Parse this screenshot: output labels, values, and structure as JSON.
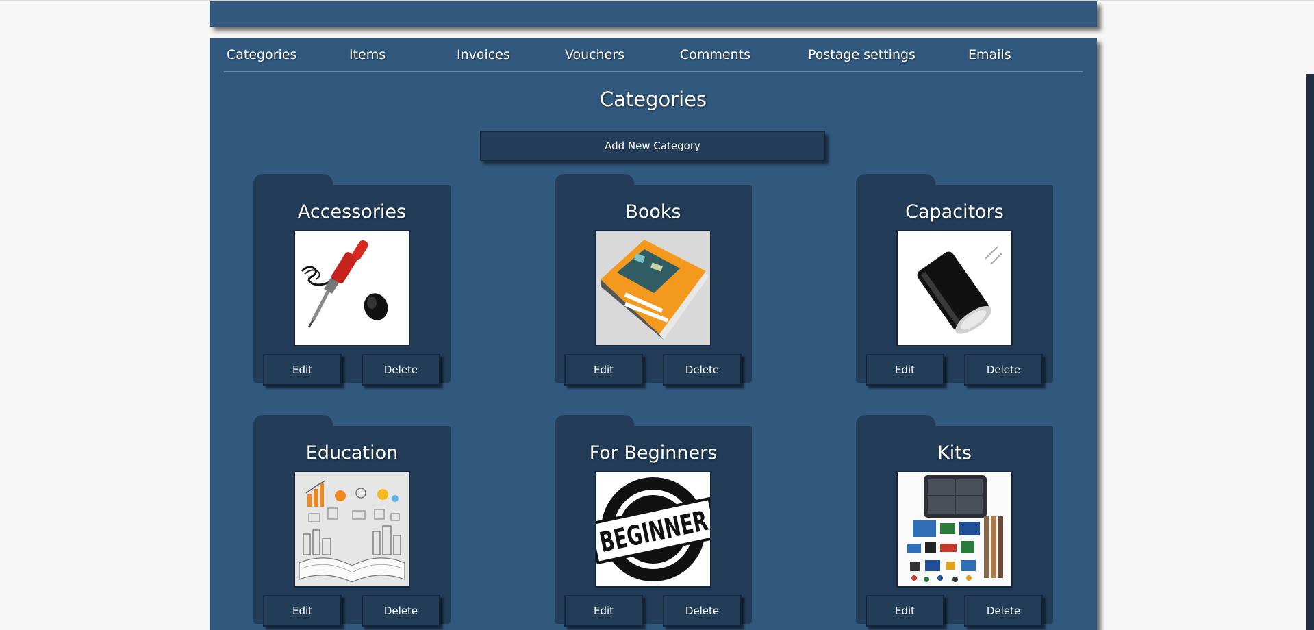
{
  "nav": {
    "items": [
      {
        "label": "Categories"
      },
      {
        "label": "Items"
      },
      {
        "label": "Invoices"
      },
      {
        "label": "Vouchers"
      },
      {
        "label": "Comments"
      },
      {
        "label": "Postage settings"
      },
      {
        "label": "Emails"
      }
    ]
  },
  "page": {
    "title": "Categories",
    "add_button_label": "Add New Category"
  },
  "categories": [
    {
      "name": "Accessories",
      "image": "soldering-iron-icon",
      "edit_label": "Edit",
      "delete_label": "Delete"
    },
    {
      "name": "Books",
      "image": "book-icon",
      "edit_label": "Edit",
      "delete_label": "Delete"
    },
    {
      "name": "Capacitors",
      "image": "capacitor-icon",
      "edit_label": "Edit",
      "delete_label": "Delete"
    },
    {
      "name": "Education",
      "image": "open-book-ideas-icon",
      "edit_label": "Edit",
      "delete_label": "Delete"
    },
    {
      "name": "For Beginners",
      "image": "beginner-stamp-image",
      "image_text": "BEGINNER",
      "edit_label": "Edit",
      "delete_label": "Delete"
    },
    {
      "name": "Kits",
      "image": "electronics-kit-icon",
      "edit_label": "Edit",
      "delete_label": "Delete"
    }
  ],
  "colors": {
    "panel": "#31587d",
    "card": "#233d58",
    "button_border": "#15263a",
    "page_background": "#f7f7f7",
    "text": "#ffffff"
  }
}
